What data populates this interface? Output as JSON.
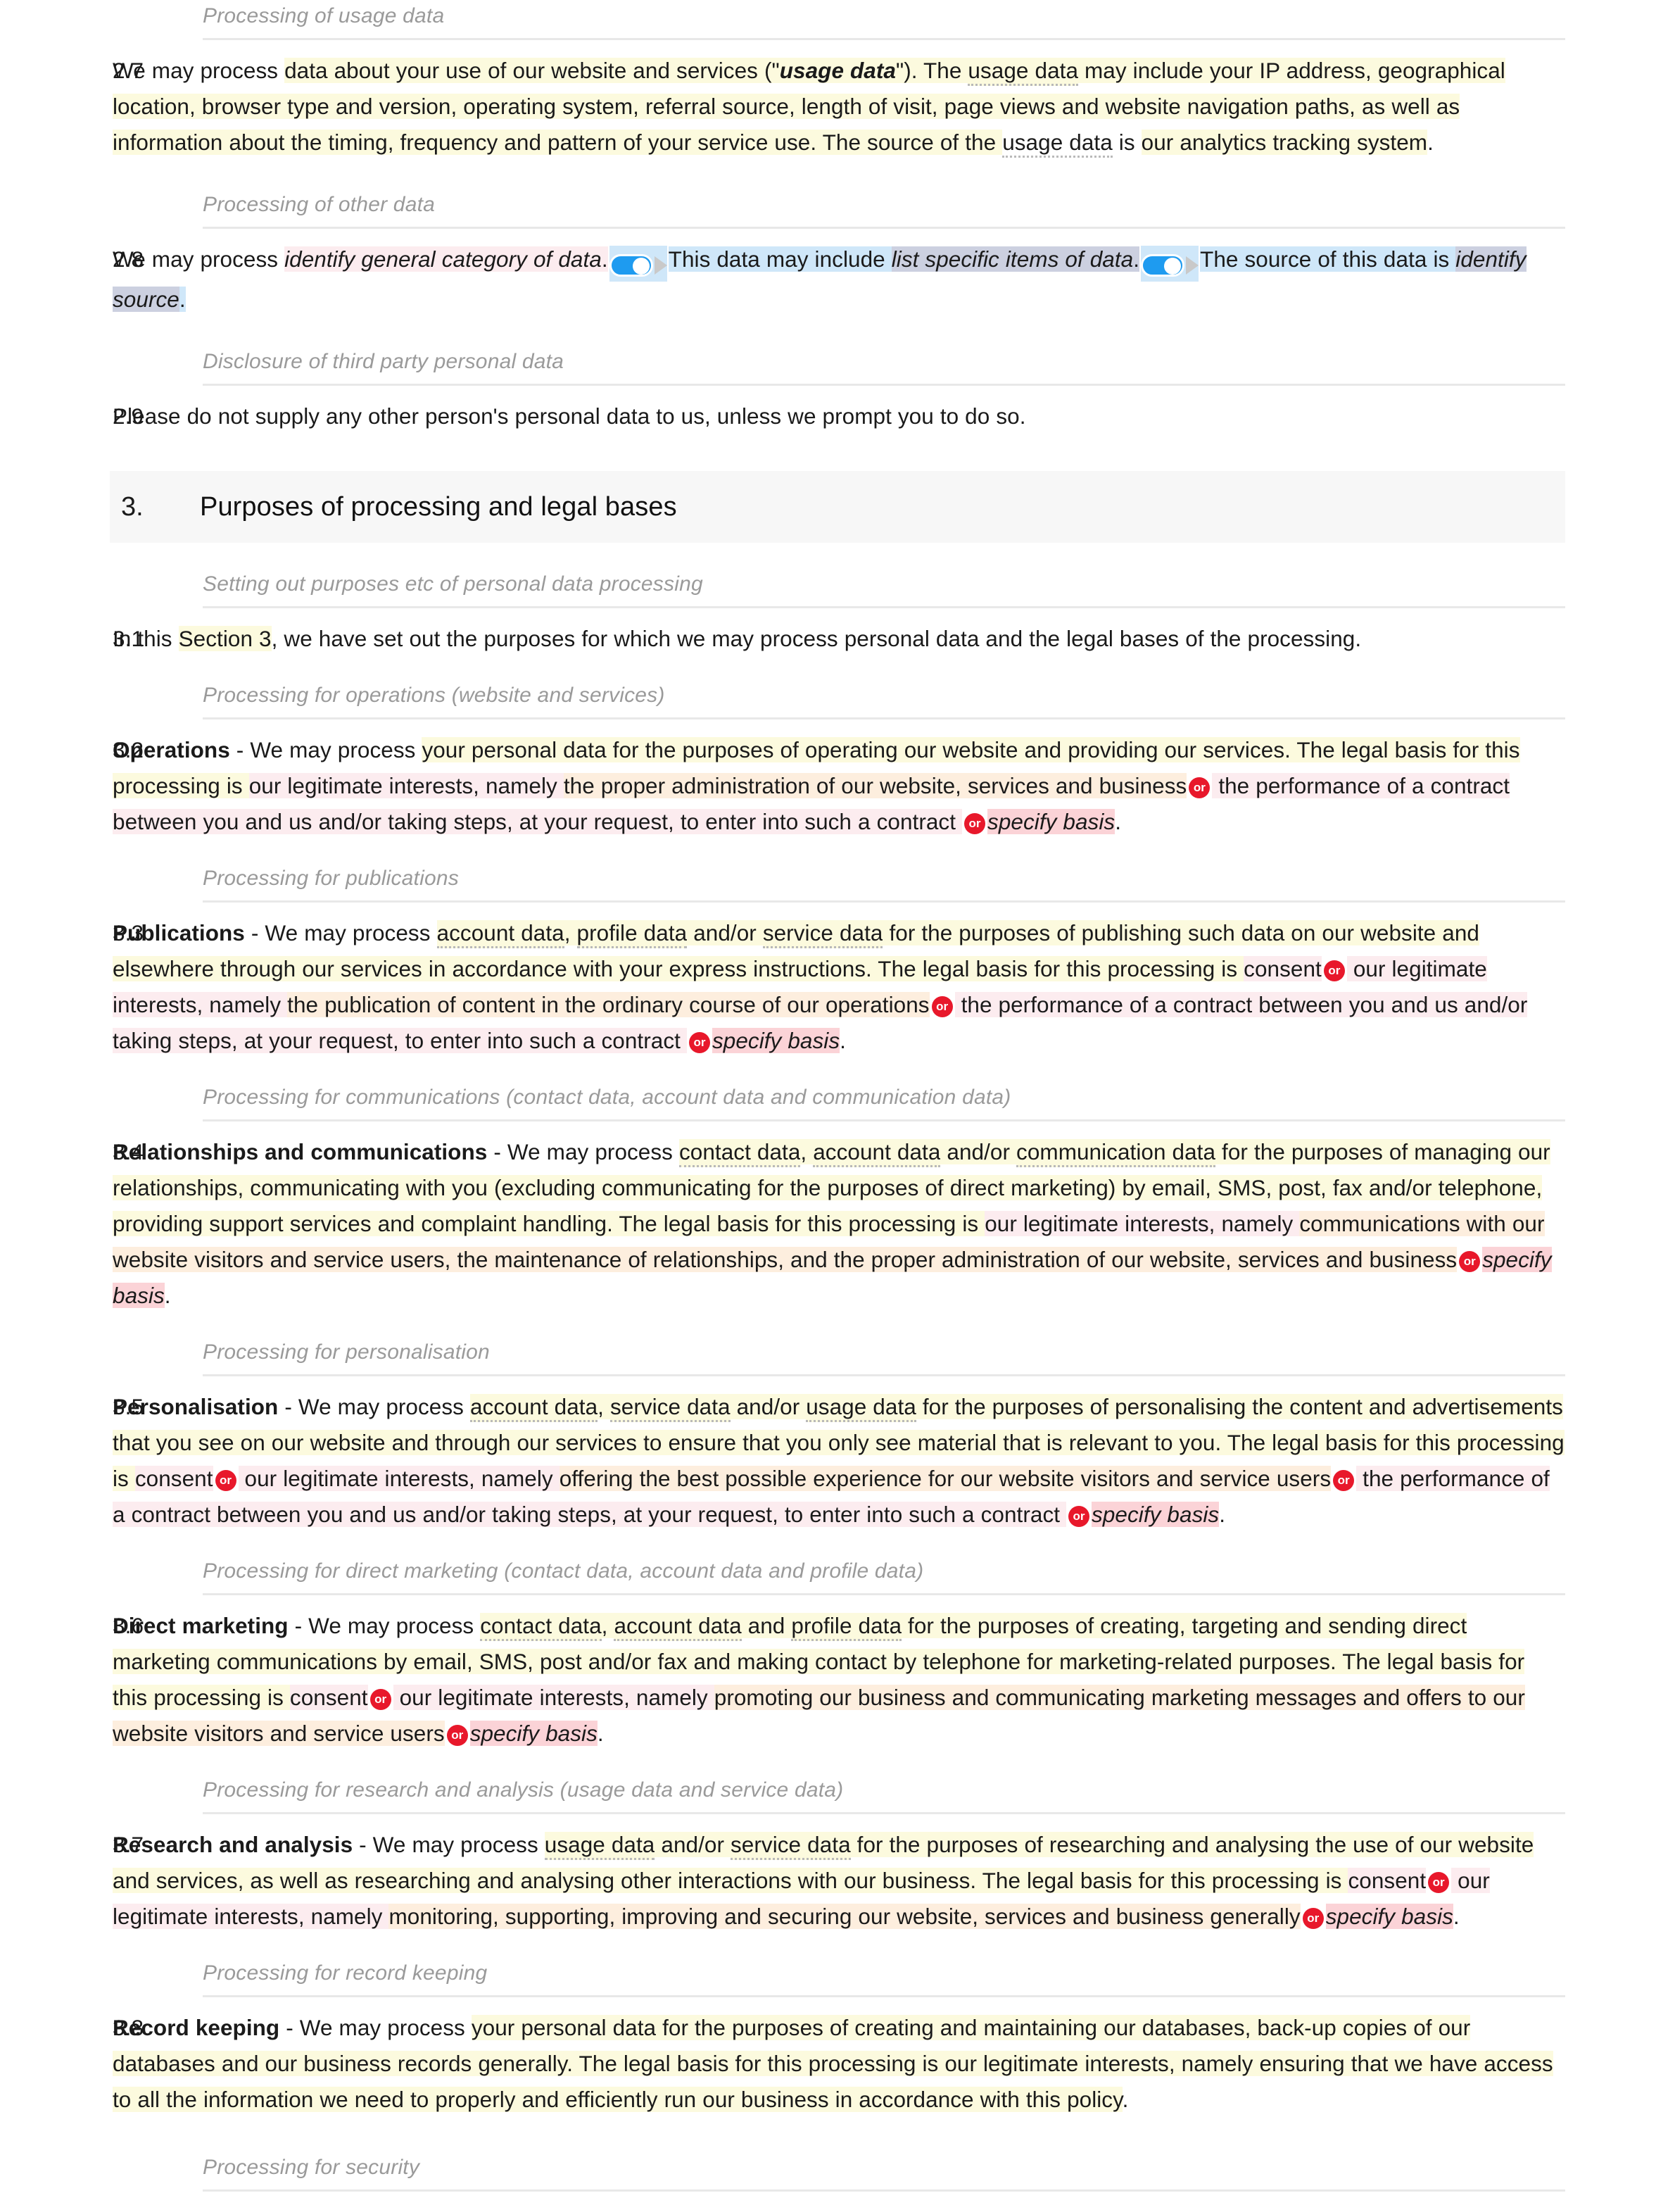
{
  "document": {
    "type": "privacy-policy-template",
    "accent_colors": {
      "or_badge_bg": "#e8182b",
      "toggle_on": "#1e9bf0",
      "section_band_bg": "#f7f7f7",
      "highlight_yellow": "#fcfade",
      "highlight_pink": "#fbdfe2",
      "highlight_peach": "#fce3cd",
      "highlight_blue": "#cfe7f9",
      "subhead_grey": "#9a9a9a",
      "rule_grey": "#e8e8e8"
    }
  },
  "subheads": {
    "usage_data": "Processing of usage data",
    "other_data": "Processing of other data",
    "third_party": "Disclosure of third party personal data",
    "setting_out": "Setting out purposes etc of personal data processing",
    "operations": "Processing for operations (website and services)",
    "publications": "Processing for publications",
    "communications": "Processing for communications (contact data, account data and communication data)",
    "personalisation": "Processing for personalisation",
    "direct_marketing": "Processing for direct marketing (contact data, account data and profile data)",
    "research": "Processing for research and analysis (usage data and service data)",
    "record_keeping": "Processing for record keeping",
    "security": "Processing for security"
  },
  "section3": {
    "number": "3.",
    "title": "Purposes of processing and legal bases"
  },
  "clauses": {
    "c27": {
      "number": "2.7",
      "t1": "We may process ",
      "t2": "data about your use of our website and services (\"",
      "t3": "usage data",
      "t4": "\"). The ",
      "t5": "usage data",
      "t6": " may include your IP address, geographical location, browser type and version, operating system, referral source, length of visit, page views and website navigation paths, as well as information about the timing, frequency and pattern of your service use. The source of the ",
      "t7": "usage data",
      "t8": " is ",
      "t9": "our analytics tracking system",
      "t10": "."
    },
    "c28": {
      "number": "2.8",
      "t1": "We may process ",
      "t2": "identify general category of data",
      "t3": ".",
      "t4": "This data may include ",
      "t5": "list specific items of data",
      "t6": ".",
      "t7": "The source of this data is ",
      "t8": "identify source",
      "t9": "."
    },
    "c29": {
      "number": "2.9",
      "text": "Please do not supply any other person's personal data to us, unless we prompt you to do so."
    },
    "c31": {
      "number": "3.1",
      "t1": "In this ",
      "t2": "Section 3",
      "t3": ", we have set out the purposes for which we may process personal data and the legal bases of the processing."
    },
    "c32": {
      "number": "3.2",
      "lead": "Operations",
      "t1": " - We may process ",
      "t2": "your personal data",
      "t3": " for the purposes of operating our website and providing our services. The legal basis for this processing is ",
      "t4": "our legitimate interests, namely ",
      "t5": "the proper administration of our website, services and business",
      "or1": "or",
      "t6": " the performance of a contract between you and us and/or taking steps, at your request, to enter into such a contract ",
      "or2": "or",
      "t7": "specify basis",
      "t8": "."
    },
    "c33": {
      "number": "3.3",
      "lead": "Publications",
      "t1": " - We may process ",
      "t2": "account data",
      "t3": ", ",
      "t4": "profile data",
      "t5": " and/or ",
      "t6": "service data",
      "t7": " for the purposes of publishing such data on our website and elsewhere through our services in accordance with your express instructions. The legal basis for this processing is ",
      "t8": "consent",
      "or1": "or",
      "t9": " our legitimate interests, namely ",
      "t10": "the publication of content in the ordinary course of our operations",
      "or2": "or",
      "t11": " the performance of a contract between you and us and/or taking steps, at your request, to enter into such a contract ",
      "or3": "or",
      "t12": "specify basis",
      "t13": "."
    },
    "c34": {
      "number": "3.4",
      "lead": "Relationships and communications",
      "t1": " - We may process ",
      "t2": "contact data",
      "t3": ", ",
      "t4": "account data",
      "t5": " and/or ",
      "t6": "communication data",
      "t7": " for the purposes of managing our relationships, communicating with you (excluding communicating for the purposes of direct marketing) by email, SMS, post, fax and/or telephone, providing support services and complaint handling. The legal basis for this processing is ",
      "t8": "our legitimate interests, namely ",
      "t9": "communications with our website visitors and service users, the maintenance of relationships, and the proper administration of our website, services and business",
      "or1": "or",
      "t10": "specify basis",
      "t11": "."
    },
    "c35": {
      "number": "3.5",
      "lead": "Personalisation",
      "t1": " - We may process ",
      "t2": "account data",
      "t3": ", ",
      "t4": "service data",
      "t5": " and/or ",
      "t6": "usage data",
      "t7": " for the purposes of personalising the content and advertisements that you see on our website and through our services to ensure that you only see material that is relevant to you. The legal basis for this processing is ",
      "t8": "consent",
      "or1": "or",
      "t9": " our legitimate interests, namely ",
      "t10": "offering the best possible experience for our website visitors and service users",
      "or2": "or",
      "t11": " the performance of a contract between you and us and/or taking steps, at your request, to enter into such a contract ",
      "or3": "or",
      "t12": "specify basis",
      "t13": "."
    },
    "c36": {
      "number": "3.6",
      "lead": "Direct marketing",
      "t1": " - We may process ",
      "t2": "contact data",
      "t3": ", ",
      "t4": "account data",
      "t5": " and ",
      "t6": "profile data",
      "t7": " for the purposes of creating, targeting and sending direct marketing communications by email, SMS, post and/or fax and making contact by telephone for marketing-related purposes. The legal basis for this processing is ",
      "t8": "consent",
      "or1": "or",
      "t9": " our legitimate interests, namely ",
      "t10": "promoting our business and communicating marketing messages and offers to our website visitors and service users",
      "or2": "or",
      "t11": "specify basis",
      "t12": "."
    },
    "c37": {
      "number": "3.7",
      "lead": "Research and analysis",
      "t1": " - We may process ",
      "t2": "usage data",
      "t3": " and/or ",
      "t4": "service data",
      "t5": " for the purposes of researching and analysing the use of our website and services, as well as researching and analysing other interactions with our business. The legal basis for this processing is ",
      "t6": "consent",
      "or1": "or",
      "t7": " our legitimate interests, namely ",
      "t8": "monitoring, supporting, improving and securing our website, services and business generally",
      "or2": "or",
      "t9": "specify basis",
      "t10": "."
    },
    "c38": {
      "number": "3.8",
      "lead": "Record keeping",
      "t1": " - We may process ",
      "t2": "your personal data",
      "t3": " for the purposes of creating and maintaining our databases, back-up copies of our databases and our business records generally. The legal basis for this processing is our legitimate interests, namely ",
      "t4": "ensuring that we have access to all the information we need to properly and efficiently run our business in accordance with this policy",
      "t5": "."
    }
  }
}
